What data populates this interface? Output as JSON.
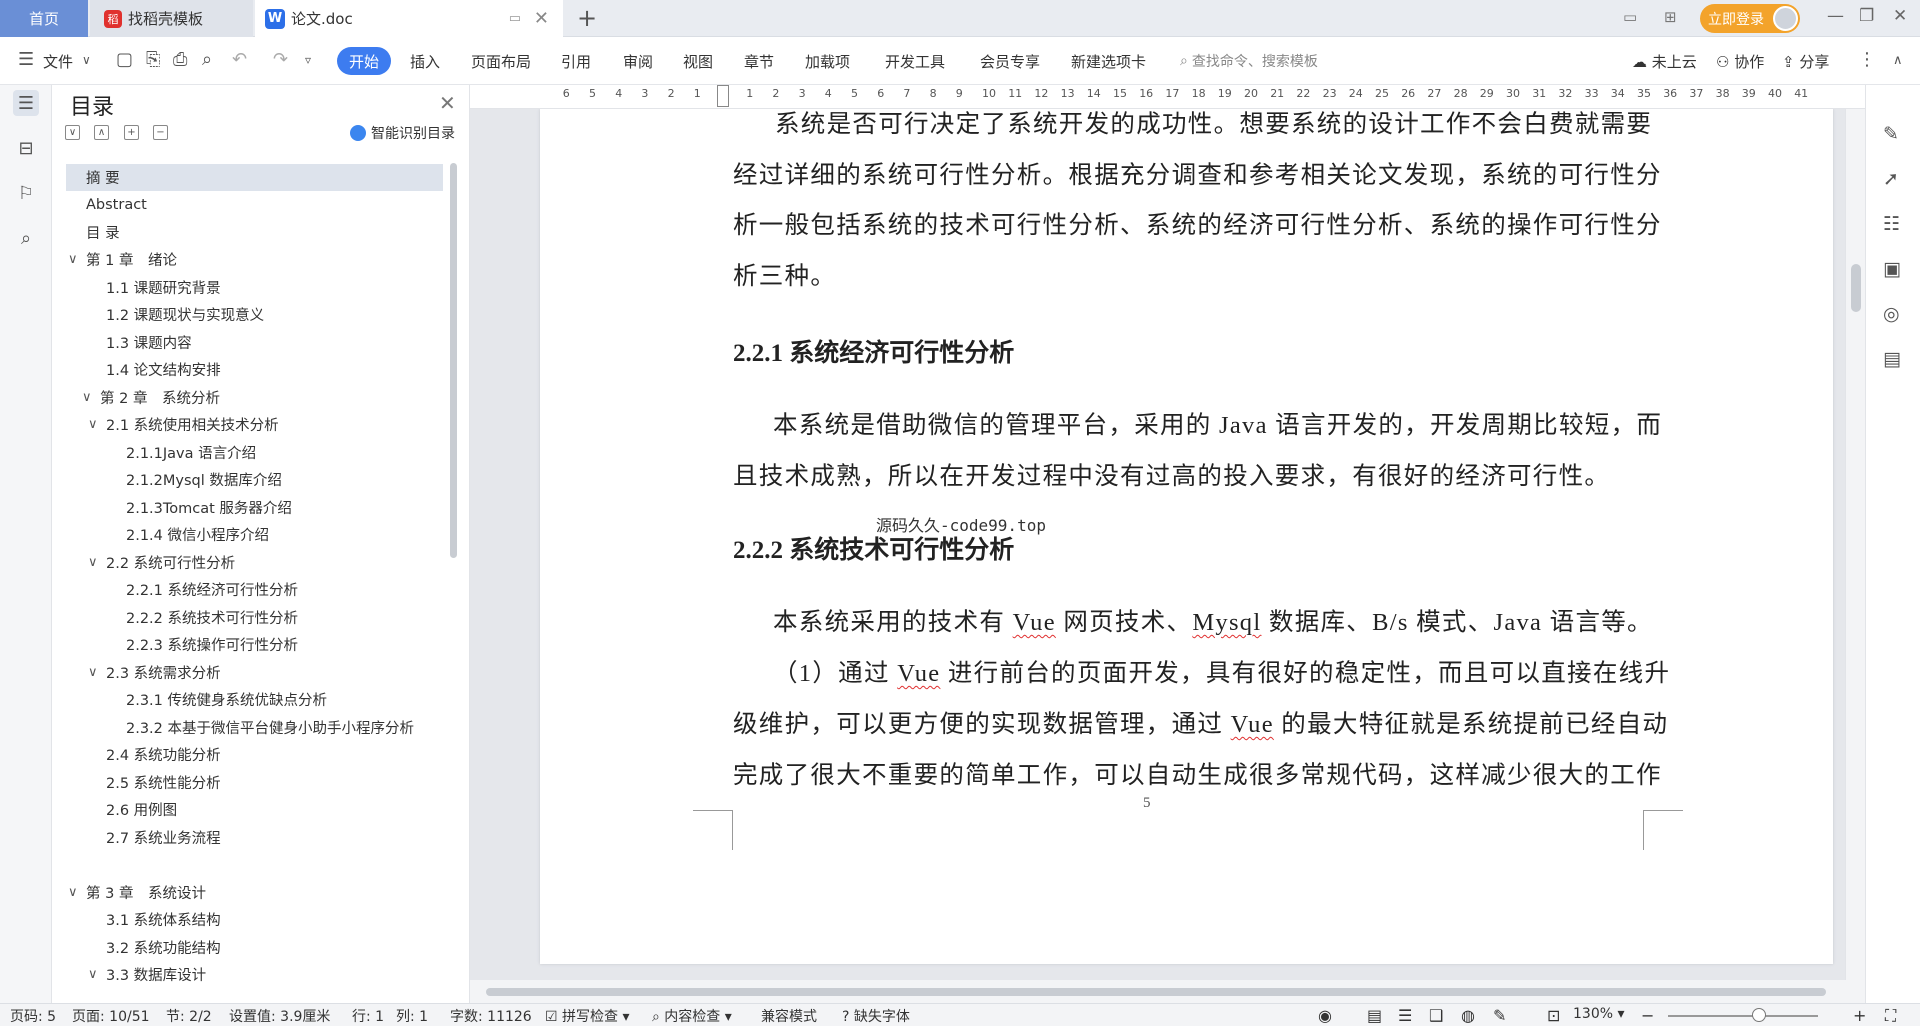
{
  "tabs": {
    "home": "首页",
    "template": "找稻壳模板",
    "doc": "论文.doc",
    "new": "+"
  },
  "window": {
    "login": "立即登录",
    "minimize": "—",
    "restore": "❐",
    "close": "✕"
  },
  "toolbar": {
    "file": "文件",
    "start": "开始",
    "menus": [
      "插入",
      "页面布局",
      "引用",
      "审阅",
      "视图",
      "章节",
      "加载项",
      "开发工具",
      "会员专享",
      "新建选项卡"
    ],
    "search_placeholder": "查找命令、搜索模板",
    "cloud": "未上云",
    "collab": "协作",
    "share": "分享"
  },
  "toc": {
    "title": "目录",
    "smart": "智能识别目录",
    "items": [
      {
        "label": "摘 要",
        "level": 0,
        "caret": "",
        "selected": true
      },
      {
        "label": "Abstract",
        "level": 0,
        "caret": ""
      },
      {
        "label": "目 录",
        "level": 0,
        "caret": ""
      },
      {
        "label": "第 1 章　绪论",
        "level": 0,
        "caret": "∨"
      },
      {
        "label": "1.1 课题研究背景",
        "level": 1,
        "caret": ""
      },
      {
        "label": "1.2 课题现状与实现意义",
        "level": 1,
        "caret": ""
      },
      {
        "label": "1.3 课题内容",
        "level": 1,
        "caret": ""
      },
      {
        "label": "1.4 论文结构安排",
        "level": 1,
        "caret": ""
      },
      {
        "label": "第 2 章　系统分析",
        "level": 0.5,
        "caret": "∨"
      },
      {
        "label": "2.1 系统使用相关技术分析",
        "level": 1,
        "caret": "∨"
      },
      {
        "label": "2.1.1Java 语言介绍",
        "level": 2,
        "caret": ""
      },
      {
        "label": "2.1.2Mysql 数据库介绍",
        "level": 2,
        "caret": ""
      },
      {
        "label": "2.1.3Tomcat 服务器介绍",
        "level": 2,
        "caret": ""
      },
      {
        "label": "2.1.4 微信小程序介绍",
        "level": 2,
        "caret": ""
      },
      {
        "label": "2.2 系统可行性分析",
        "level": 1,
        "caret": "∨"
      },
      {
        "label": "2.2.1 系统经济可行性分析",
        "level": 2,
        "caret": ""
      },
      {
        "label": "2.2.2 系统技术可行性分析",
        "level": 2,
        "caret": ""
      },
      {
        "label": "2.2.3 系统操作可行性分析",
        "level": 2,
        "caret": ""
      },
      {
        "label": "2.3 系统需求分析",
        "level": 1,
        "caret": "∨"
      },
      {
        "label": "2.3.1 传统健身系统优缺点分析",
        "level": 2,
        "caret": ""
      },
      {
        "label": "2.3.2 本基于微信平台健身小助手小程序分析",
        "level": 2,
        "caret": ""
      },
      {
        "label": "2.4 系统功能分析",
        "level": 1,
        "caret": ""
      },
      {
        "label": "2.5 系统性能分析",
        "level": 1,
        "caret": ""
      },
      {
        "label": "2.6 用例图",
        "level": 1,
        "caret": ""
      },
      {
        "label": "2.7 系统业务流程",
        "level": 1,
        "caret": ""
      },
      {
        "label": "",
        "level": 0,
        "caret": ""
      },
      {
        "label": "第 3 章　系统设计",
        "level": 0,
        "caret": "∨"
      },
      {
        "label": "3.1 系统体系结构",
        "level": 1,
        "caret": ""
      },
      {
        "label": "3.2 系统功能结构",
        "level": 1,
        "caret": ""
      },
      {
        "label": "3.3 数据库设计",
        "level": 1,
        "caret": "∨"
      }
    ]
  },
  "ruler": {
    "left_numbers": [
      "6",
      "5",
      "4",
      "3",
      "2",
      "1"
    ],
    "right_numbers": [
      "1",
      "2",
      "3",
      "4",
      "5",
      "6",
      "7",
      "8",
      "9",
      "10",
      "11",
      "12",
      "13",
      "14",
      "15",
      "16",
      "17",
      "18",
      "19",
      "20",
      "21",
      "22",
      "23",
      "24",
      "25",
      "26",
      "27",
      "28",
      "29",
      "30",
      "31",
      "32",
      "33",
      "34",
      "35",
      "36",
      "37",
      "38",
      "39",
      "40",
      "41"
    ]
  },
  "doc": {
    "p1": [
      "系统是否可行决定了系统开发的成功性。想要系统的设计工作不会白费就需要",
      "经过详细的系统可行性分析。根据充分调查和参考相关论文发现，系统的可行性分",
      "析一般包括系统的技术可行性分析、系统的经济可行性分析、系统的操作可行性分",
      "析三种。"
    ],
    "h1": "2.2.1 系统经济可行性分析",
    "p2": [
      "本系统是借助微信的管理平台，采用的 Java 语言开发的，开发周期比较短，而",
      "且技术成熟，所以在开发过程中没有过高的投入要求，有很好的经济可行性。"
    ],
    "watermark": "源码久久-code99.top",
    "h2": "2.2.2 系统技术可行性分析",
    "p3a": "本系统采用的技术有",
    "p3_vue": "Vue",
    "p3b": " 网页技术、",
    "p3_mysql": "Mysql",
    "p3c": " 数据库、B/s 模式、Java 语言等。",
    "p4a": "（1）通过 ",
    "p4b": " 进行前台的页面开发，具有很好的稳定性，而且可以直接在线升",
    "p5a": "级维护，可以更方便的实现数据管理，通过 ",
    "p5b": " 的最大特征就是系统提前已经自动",
    "p6": "完成了很大不重要的简单工作，可以自动生成很多常规代码，这样减少很大的工作",
    "page_number": "5"
  },
  "status": {
    "page_code": "页码: 5",
    "page": "页面: 10/51",
    "section": "节: 2/2",
    "setting": "设置值: 3.9厘米",
    "row": "行: 1",
    "col": "列: 1",
    "words": "字数: 11126",
    "spell": "拼写检查",
    "content_check": "内容检查",
    "compat": "兼容模式",
    "missing_font": "缺失字体",
    "zoom": "130%"
  }
}
